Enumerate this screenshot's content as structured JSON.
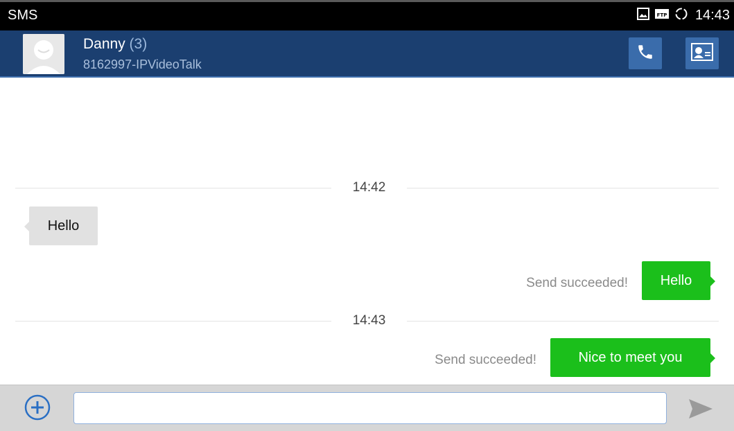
{
  "status_bar": {
    "app_title": "SMS",
    "icons": [
      "image-icon",
      "ftp-icon",
      "sync-icon"
    ],
    "ftp_label": "FTP",
    "time": "14:43"
  },
  "header": {
    "contact_name": "Danny",
    "message_count": "(3)",
    "contact_number": "8162997-IPVideoTalk",
    "actions": [
      "phone-call-icon",
      "contact-card-icon"
    ]
  },
  "conversation": {
    "groups": [
      {
        "time": "14:42",
        "messages": [
          {
            "direction": "incoming",
            "text": "Hello"
          },
          {
            "direction": "outgoing",
            "text": "Hello",
            "status": "Send succeeded!"
          }
        ]
      },
      {
        "time": "14:43",
        "messages": [
          {
            "direction": "outgoing",
            "text": "Nice to meet you",
            "status": "Send succeeded!"
          }
        ]
      }
    ]
  },
  "compose": {
    "input_value": "",
    "input_placeholder": "",
    "add_icon": "plus-circle-icon",
    "send_icon": "send-icon"
  },
  "colors": {
    "status_bar_bg": "#000000",
    "header_bg": "#1b3f70",
    "header_button_bg": "#3a6cab",
    "outgoing_bubble": "#1bbf1b",
    "incoming_bubble": "#e1e1e1",
    "compose_bar_bg": "#d6d6d6",
    "accent_blue": "#2a6fc4"
  }
}
